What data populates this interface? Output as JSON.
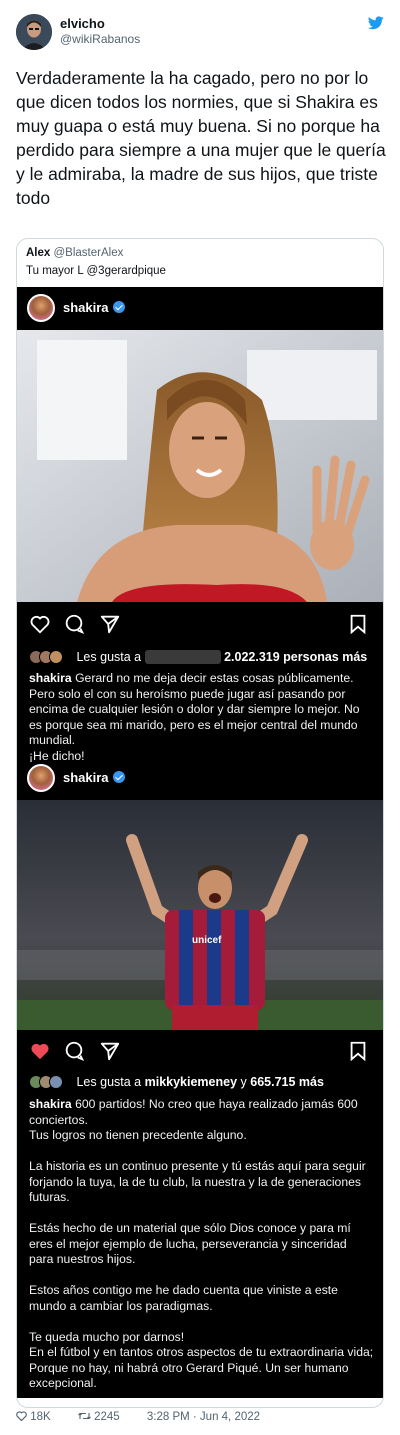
{
  "tweet": {
    "author_name": "elvicho",
    "author_handle": "@wikiRabanos",
    "text": "Verdaderamente la ha cagado, pero no por lo que dicen todos los normies, que si Shakira es muy guapa o está muy buena. Si no porque ha perdido para siempre a una mujer que le quería y le admiraba, la madre de sus hijos, que triste todo",
    "icon": "twitter-bird-icon",
    "accent_color": "#1d9bf0"
  },
  "quote": {
    "author_name": "Alex",
    "author_handle": "@BlasterAlex",
    "text": "Tu mayor L @3gerardpique"
  },
  "post1": {
    "username": "shakira",
    "likes_prefix": "Les gusta a",
    "likes_count": "2.022.319 personas más",
    "caption_user": "shakira",
    "caption": "Gerard no me deja decir estas cosas públicamente. Pero solo el con su heroísmo puede jugar así pasando por encima de cualquier lesión o dolor y dar siempre lo mejor. No es porque sea mi marido, pero es el mejor central del mundo mundial.",
    "caption_end": "¡He dicho!"
  },
  "post2": {
    "username": "shakira",
    "likes_prefix": "Les gusta a",
    "likes_user": "mikkykiemeney",
    "likes_join": "y",
    "likes_count": "665.715 más",
    "caption_user": "shakira",
    "p1": "600 partidos! No creo que haya realizado jamás 600 conciertos.",
    "p1b": "Tus logros no tienen precedente alguno.",
    "p2": "La historia es un continuo presente y tú estás aquí para seguir forjando la tuya, la de tu club, la nuestra y la de generaciones futuras.",
    "p3": "Estás hecho de un material que sólo Dios conoce y para mí eres el mejor ejemplo de lucha, perseverancia y sinceridad para nuestros hijos.",
    "p4": "Estos años contigo me he dado cuenta que viniste a este mundo a cambiar los paradigmas.",
    "p5a": "Te queda mucho por darnos!",
    "p5b": "En el fútbol y en tantos otros aspectos de tu extraordinaria vida;",
    "p5c": "Porque no hay, ni habrá otro Gerard Piqué. Un ser humano excepcional.",
    "jersey_text": "unicef"
  },
  "footer": {
    "likes": "18K",
    "retweets": "2245",
    "timestamp": "3:28 PM · Jun 4, 2022"
  }
}
